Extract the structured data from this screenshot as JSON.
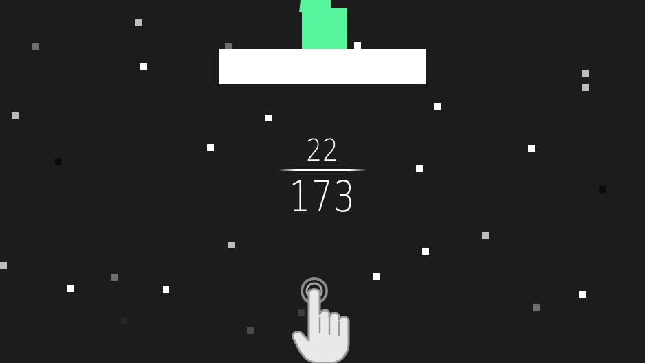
{
  "game": {
    "score_current": "22",
    "score_best": "173"
  },
  "colors": {
    "background": "#1c1c1c",
    "platform": "#ffffff",
    "player": "#55f59c",
    "particle_bright": "#ffffff",
    "particle_mid": "#bdbdbd",
    "particle_dim": "#6e6e6e",
    "particle_dark": "#0a0a0a"
  },
  "icons": {
    "tap_hint": "tap-hand-icon",
    "player": "player-block-icon"
  }
}
